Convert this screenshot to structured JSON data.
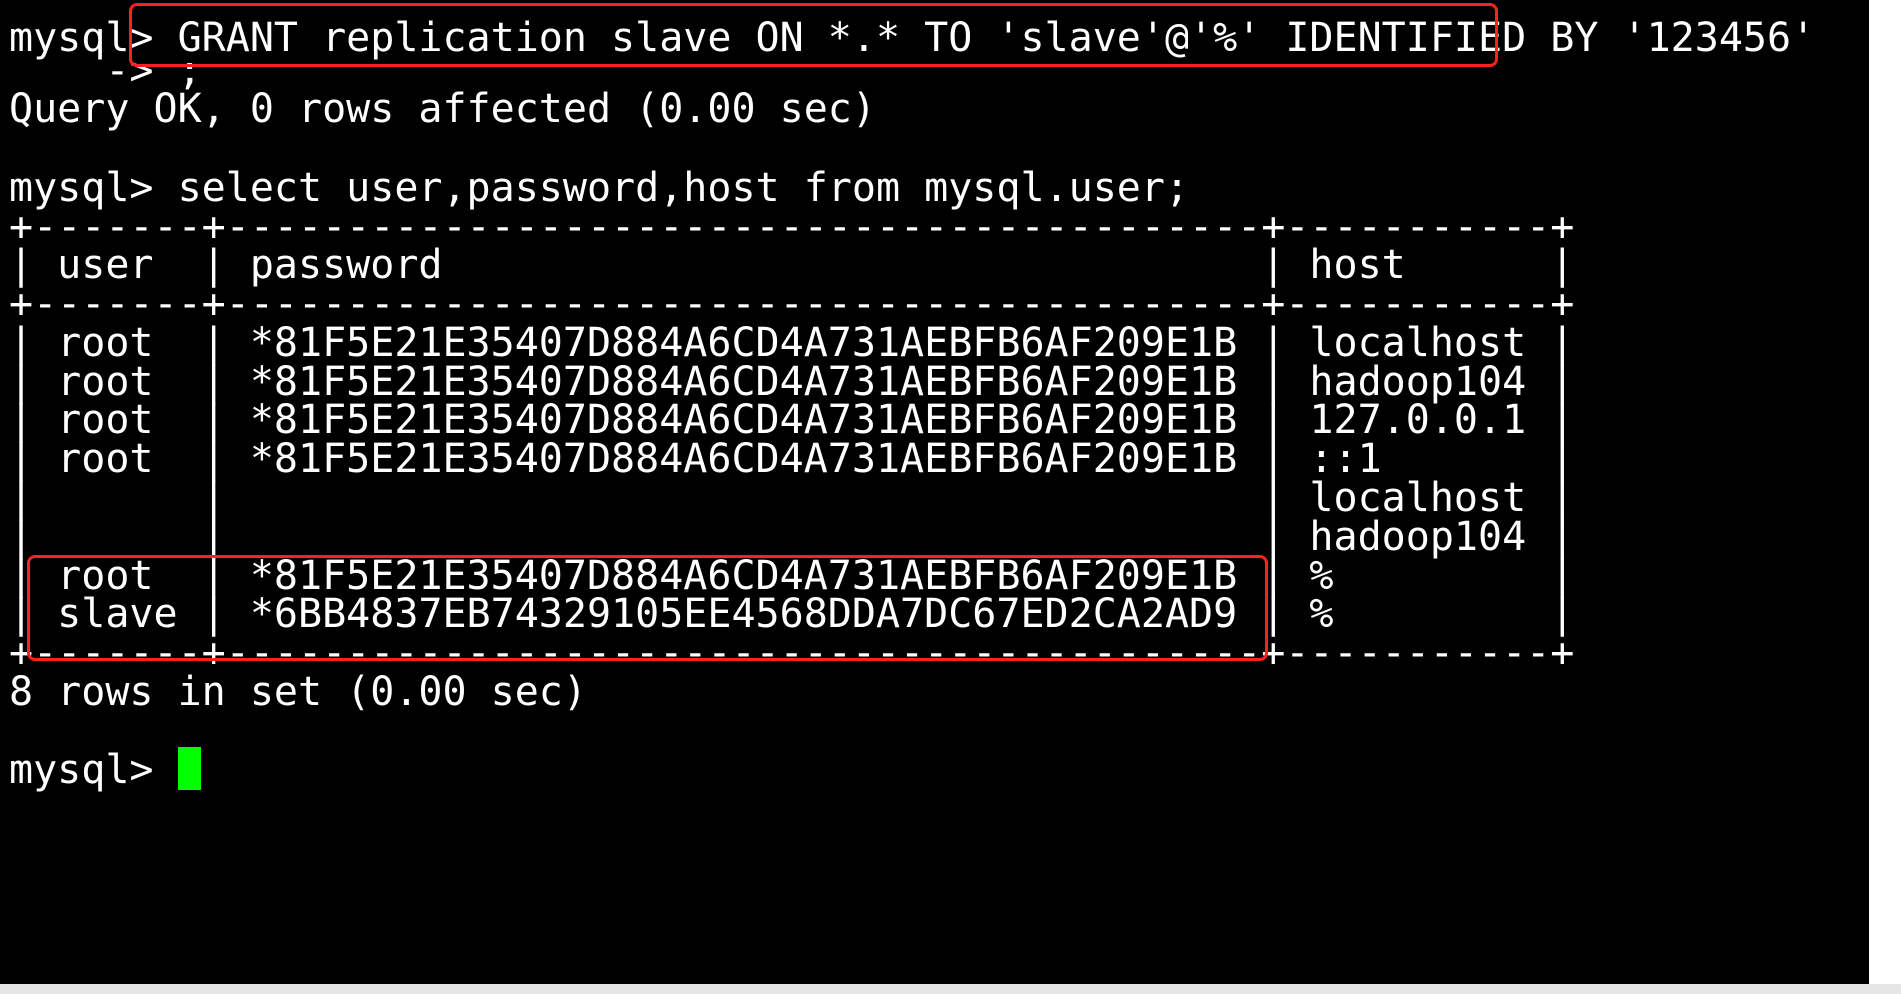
{
  "terminal": {
    "lines": [
      "mysql> GRANT replication slave ON *.* TO 'slave'@'%' IDENTIFIED BY '123456'",
      "    -> ;",
      "Query OK, 0 rows affected (0.00 sec)",
      "",
      "mysql> select user,password,host from mysql.user;",
      "+-------+-------------------------------------------+-----------+",
      "| user  | password                                  | host      |",
      "+-------+-------------------------------------------+-----------+",
      "| root  | *81F5E21E35407D884A6CD4A731AEBFB6AF209E1B | localhost |",
      "| root  | *81F5E21E35407D884A6CD4A731AEBFB6AF209E1B | hadoop104 |",
      "| root  | *81F5E21E35407D884A6CD4A731AEBFB6AF209E1B | 127.0.0.1 |",
      "| root  | *81F5E21E35407D884A6CD4A731AEBFB6AF209E1B | ::1       |",
      "|       |                                           | localhost |",
      "|       |                                           | hadoop104 |",
      "| root  | *81F5E21E35407D884A6CD4A731AEBFB6AF209E1B | %         |",
      "| slave | *6BB4837EB74329105EE4568DDA7DC67ED2CA2AD9 | %         |",
      "+-------+-------------------------------------------+-----------+",
      "8 rows in set (0.00 sec)",
      ""
    ],
    "prompt": "mysql> ",
    "colors": {
      "background": "#000000",
      "foreground": "#ffffff",
      "cursor": "#00ff00",
      "highlight": "#ff2020"
    }
  }
}
